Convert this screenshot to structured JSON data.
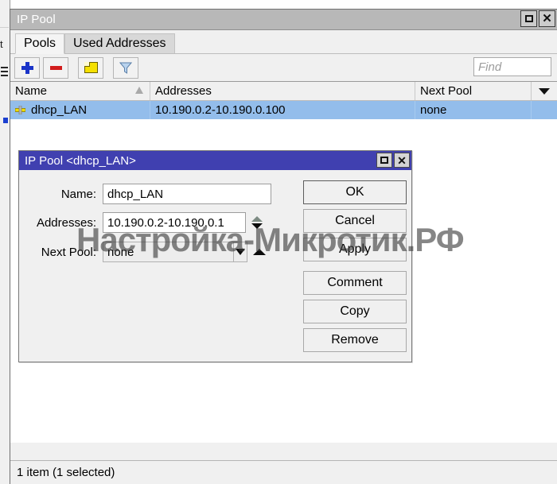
{
  "window": {
    "title": "IP Pool",
    "buttons": {
      "maximize": "maximize-icon",
      "close": "close-icon"
    }
  },
  "tabs": [
    {
      "label": "Pools",
      "active": true
    },
    {
      "label": "Used Addresses",
      "active": false
    }
  ],
  "toolbar": {
    "add_icon": "plus-icon",
    "remove_icon": "minus-icon",
    "comment_icon": "note-icon",
    "filter_icon": "funnel-icon",
    "find_placeholder": "Find"
  },
  "table": {
    "columns": [
      "Name",
      "Addresses",
      "Next Pool"
    ],
    "rows": [
      {
        "icon": "pool-icon",
        "name": "dhcp_LAN",
        "addresses": "10.190.0.2-10.190.0.100",
        "next_pool": "none",
        "selected": true
      }
    ]
  },
  "status_bar": {
    "text": "1 item (1 selected)"
  },
  "dialog": {
    "title": "IP Pool <dhcp_LAN>",
    "fields": {
      "name": {
        "label": "Name:",
        "value": "dhcp_LAN"
      },
      "addresses": {
        "label": "Addresses:",
        "value": "10.190.0.2-10.190.0.1"
      },
      "next_pool": {
        "label": "Next Pool:",
        "value": "none"
      }
    },
    "buttons": [
      {
        "id": "ok",
        "label": "OK"
      },
      {
        "id": "cancel",
        "label": "Cancel"
      },
      {
        "id": "apply",
        "label": "Apply"
      },
      {
        "id": "comment",
        "label": "Comment"
      },
      {
        "id": "copy",
        "label": "Copy"
      },
      {
        "id": "remove",
        "label": "Remove"
      }
    ]
  },
  "watermark": {
    "text": "Настройка-Микротик.РФ"
  },
  "colors": {
    "window_titlebar": "#b8b8b8",
    "dialog_titlebar": "#4040b0",
    "selection": "#93bdeb",
    "accent_plus": "#1a34c8",
    "accent_minus": "#d21c1c",
    "note_yellow": "#f5e000"
  }
}
